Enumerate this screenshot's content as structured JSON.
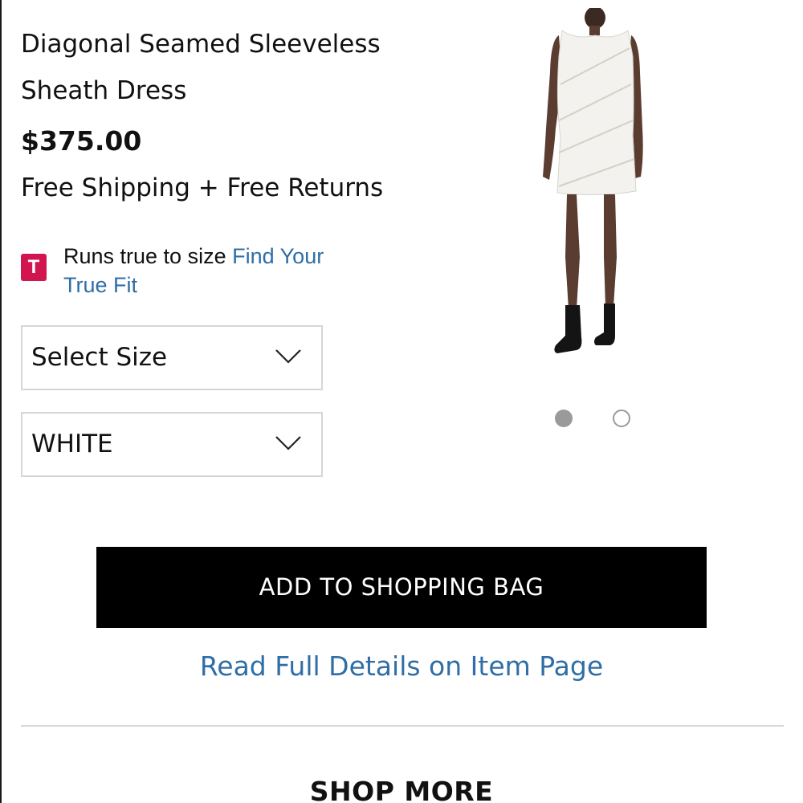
{
  "product": {
    "title_line1": "Diagonal Seamed Sleeveless",
    "title_line2": "Sheath Dress",
    "price": "$375.00",
    "shipping": "Free Shipping + Free Returns"
  },
  "fit": {
    "badge": "T",
    "text": "Runs true to size",
    "link": "Find Your True Fit"
  },
  "size_select": {
    "selected": "Select Size",
    "icon": "chevron-down-icon"
  },
  "color_select": {
    "selected": "WHITE",
    "icon": "chevron-down-icon"
  },
  "carousel": {
    "total": 2,
    "active_index": 0
  },
  "actions": {
    "add_to_bag": "ADD TO SHOPPING BAG",
    "details_link": "Read Full Details on Item Page"
  },
  "section": {
    "shop_more": "SHOP MORE"
  },
  "colors": {
    "accent_link": "#2f6ea6",
    "badge": "#d0154f",
    "button": "#000000"
  }
}
